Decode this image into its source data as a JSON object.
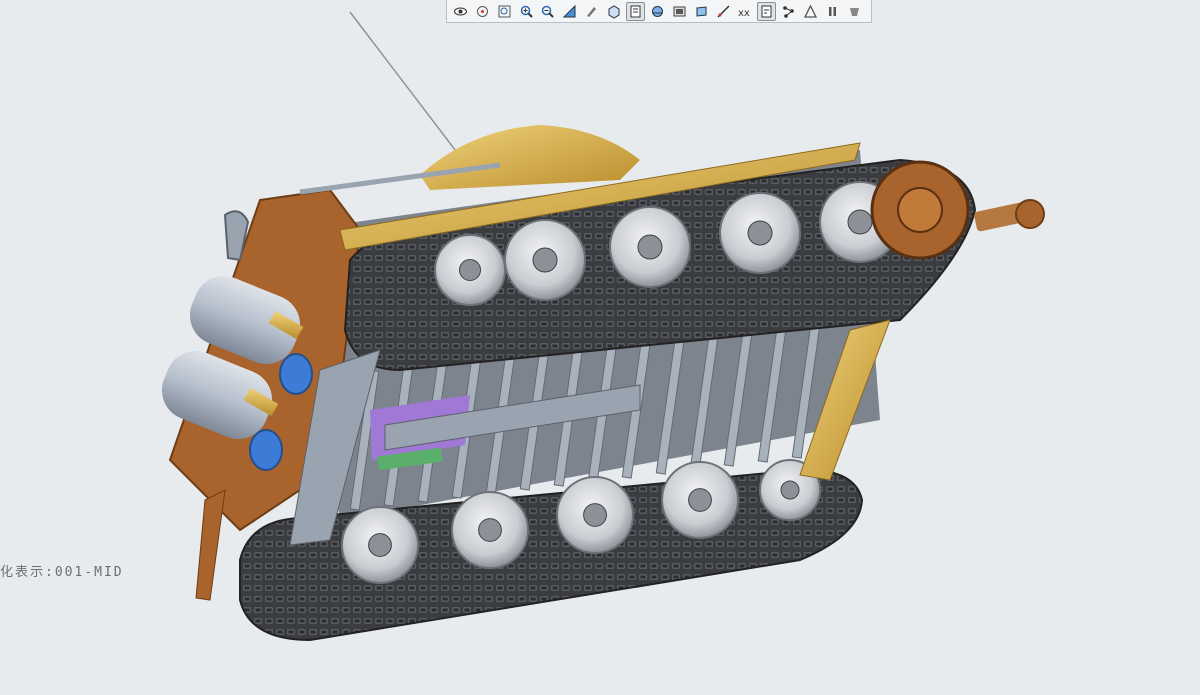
{
  "toolbar": {
    "buttons": [
      {
        "icon": "eye-icon",
        "active": false
      },
      {
        "icon": "spin-center-icon",
        "active": false
      },
      {
        "icon": "zoom-fit-icon",
        "active": false
      },
      {
        "icon": "zoom-in-icon",
        "active": false
      },
      {
        "icon": "zoom-out-icon",
        "active": false
      },
      {
        "icon": "reorient-icon",
        "active": false
      },
      {
        "icon": "view-manager-icon",
        "active": false
      },
      {
        "icon": "cube-view-icon",
        "active": false
      },
      {
        "icon": "saved-orientations-icon",
        "active": true
      },
      {
        "icon": "display-style-icon",
        "active": false
      },
      {
        "icon": "datum-display-icon",
        "active": false
      },
      {
        "icon": "shading-icon",
        "active": false
      },
      {
        "icon": "section-icon",
        "active": false
      },
      {
        "icon": "point-display-icon",
        "active": false
      },
      {
        "icon": "csys-display-icon",
        "active": true
      },
      {
        "icon": "annotation-display-icon",
        "active": false
      },
      {
        "icon": "spin-center-display-icon",
        "active": false
      },
      {
        "icon": "pause-icon",
        "active": false
      },
      {
        "icon": "appearance-icon",
        "active": false
      }
    ]
  },
  "viewport": {
    "view_label": "化表示:001-MID",
    "colors": {
      "background": "#e8ebee",
      "hull_brown": "#a8642c",
      "brass": "#d4aa4a",
      "track_dark": "#3a3c40",
      "wheel_grey": "#c9ccd1",
      "steel_blue": "#9aa3b0",
      "tank_blue": "#3d7cd6",
      "purple_part": "#a078d6",
      "green_part": "#5ab06a"
    }
  }
}
